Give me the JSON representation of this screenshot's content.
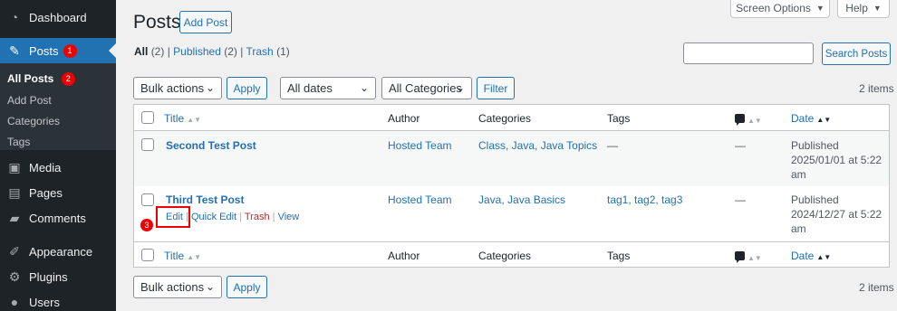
{
  "sidebar": {
    "items": [
      {
        "label": "Dashboard",
        "icon": "dashboard-icon"
      },
      {
        "label": "Posts",
        "icon": "pushpin-icon",
        "badge": "1"
      },
      {
        "label": "Media",
        "icon": "media-icon"
      },
      {
        "label": "Pages",
        "icon": "pages-icon"
      },
      {
        "label": "Comments",
        "icon": "comments-icon"
      },
      {
        "label": "Appearance",
        "icon": "appearance-icon"
      },
      {
        "label": "Plugins",
        "icon": "plugins-icon"
      },
      {
        "label": "Users",
        "icon": "users-icon"
      }
    ],
    "submenu": [
      {
        "label": "All Posts",
        "badge": "2"
      },
      {
        "label": "Add Post"
      },
      {
        "label": "Categories"
      },
      {
        "label": "Tags"
      }
    ]
  },
  "header": {
    "title": "Posts",
    "add_post": "Add Post",
    "screen_options": "Screen Options",
    "help": "Help"
  },
  "filters": {
    "all": "All",
    "all_count": "(2)",
    "published": "Published",
    "published_count": "(2)",
    "trash": "Trash",
    "trash_count": "(1)",
    "sep": "|",
    "search_button": "Search Posts",
    "bulk_actions": "Bulk actions",
    "apply": "Apply",
    "dates": "All dates",
    "categories": "All Categories",
    "filter": "Filter",
    "items_count": "2 items"
  },
  "table": {
    "columns": {
      "title": "Title",
      "author": "Author",
      "categories": "Categories",
      "tags": "Tags",
      "date": "Date"
    },
    "rows": [
      {
        "title": "Second Test Post",
        "author": "Hosted Team",
        "categories": "Class, Java, Java Topics",
        "tags": "—",
        "comments": "—",
        "status": "Published",
        "date_line1": "2025/01/01 at 5:22",
        "date_line2": "am"
      },
      {
        "title": "Third Test Post",
        "author": "Hosted Team",
        "categories": "Java, Java Basics",
        "tags": "tag1, tag2, tag3",
        "comments": "—",
        "status": "Published",
        "date_line1": "2024/12/27 at 5:22",
        "date_line2": "am",
        "actions": {
          "edit": "Edit",
          "quick_edit": "Quick Edit",
          "trash": "Trash",
          "view": "View"
        }
      }
    ]
  },
  "annotation": {
    "step": "3"
  }
}
